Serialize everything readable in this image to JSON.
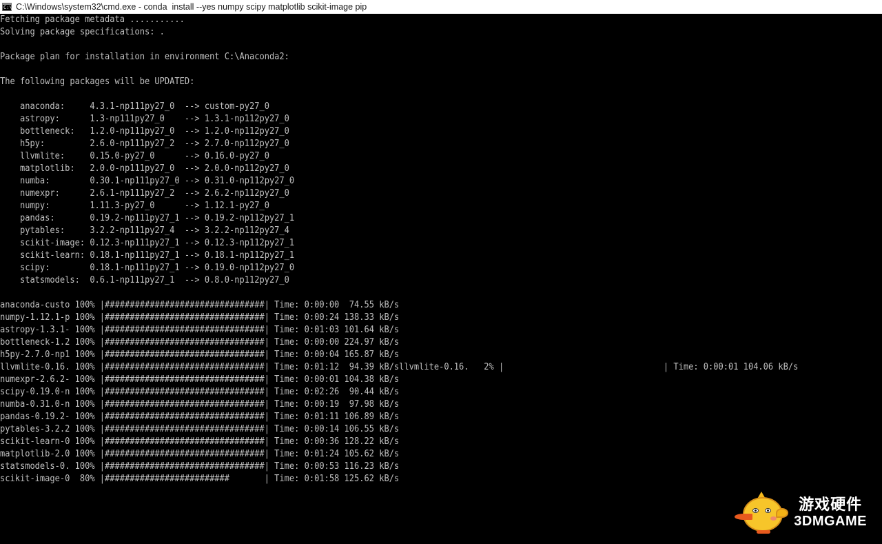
{
  "window": {
    "title": "C:\\Windows\\system32\\cmd.exe - conda  install --yes numpy scipy matplotlib scikit-image pip",
    "icon": "cmd-icon",
    "icon_glyph": "C:\\"
  },
  "console": {
    "lines": [
      "Fetching package metadata ...........",
      "Solving package specifications: .",
      "",
      "Package plan for installation in environment C:\\Anaconda2:",
      "",
      "The following packages will be UPDATED:",
      "",
      "    anaconda:     4.3.1-np111py27_0  --> custom-py27_0",
      "    astropy:      1.3-np111py27_0    --> 1.3.1-np112py27_0",
      "    bottleneck:   1.2.0-np111py27_0  --> 1.2.0-np112py27_0",
      "    h5py:         2.6.0-np111py27_2  --> 2.7.0-np112py27_0",
      "    llvmlite:     0.15.0-py27_0      --> 0.16.0-py27_0",
      "    matplotlib:   2.0.0-np111py27_0  --> 2.0.0-np112py27_0",
      "    numba:        0.30.1-np111py27_0 --> 0.31.0-np112py27_0",
      "    numexpr:      2.6.1-np111py27_2  --> 2.6.2-np112py27_0",
      "    numpy:        1.11.3-py27_0      --> 1.12.1-py27_0",
      "    pandas:       0.19.2-np111py27_1 --> 0.19.2-np112py27_1",
      "    pytables:     3.2.2-np111py27_4  --> 3.2.2-np112py27_4",
      "    scikit-image: 0.12.3-np111py27_1 --> 0.12.3-np112py27_1",
      "    scikit-learn: 0.18.1-np111py27_1 --> 0.18.1-np112py27_1",
      "    scipy:        0.18.1-np111py27_1 --> 0.19.0-np112py27_0",
      "    statsmodels:  0.6.1-np111py27_1  --> 0.8.0-np112py27_0",
      "",
      "anaconda-custo 100% |################################| Time: 0:00:00  74.55 kB/s",
      "numpy-1.12.1-p 100% |################################| Time: 0:00:24 138.33 kB/s",
      "astropy-1.3.1- 100% |################################| Time: 0:01:03 101.64 kB/s",
      "bottleneck-1.2 100% |################################| Time: 0:00:00 224.97 kB/s",
      "h5py-2.7.0-np1 100% |################################| Time: 0:00:04 165.87 kB/s",
      "llvmlite-0.16. 100% |################################| Time: 0:01:12  94.39 kB/sllvmlite-0.16.   2% |                                | Time: 0:00:01 104.06 kB/s",
      "numexpr-2.6.2- 100% |################################| Time: 0:00:01 104.38 kB/s",
      "scipy-0.19.0-n 100% |################################| Time: 0:02:26  90.44 kB/s",
      "numba-0.31.0-n 100% |################################| Time: 0:00:19  97.98 kB/s",
      "pandas-0.19.2- 100% |################################| Time: 0:01:11 106.89 kB/s",
      "pytables-3.2.2 100% |################################| Time: 0:00:14 106.55 kB/s",
      "scikit-learn-0 100% |################################| Time: 0:00:36 128.22 kB/s",
      "matplotlib-2.0 100% |################################| Time: 0:01:24 105.62 kB/s",
      "statsmodels-0. 100% |################################| Time: 0:00:53 116.23 kB/s",
      "scikit-image-0  80% |#########################       | Time: 0:01:58 125.62 kB/s"
    ]
  },
  "watermark": {
    "mascot": "chick-mascot-icon",
    "text_cn": "游戏硬件",
    "text_en": "3DMGAME"
  },
  "colors": {
    "console_bg": "#000000",
    "console_fg": "#c0c0c0",
    "titlebar_bg": "#ffffff"
  }
}
